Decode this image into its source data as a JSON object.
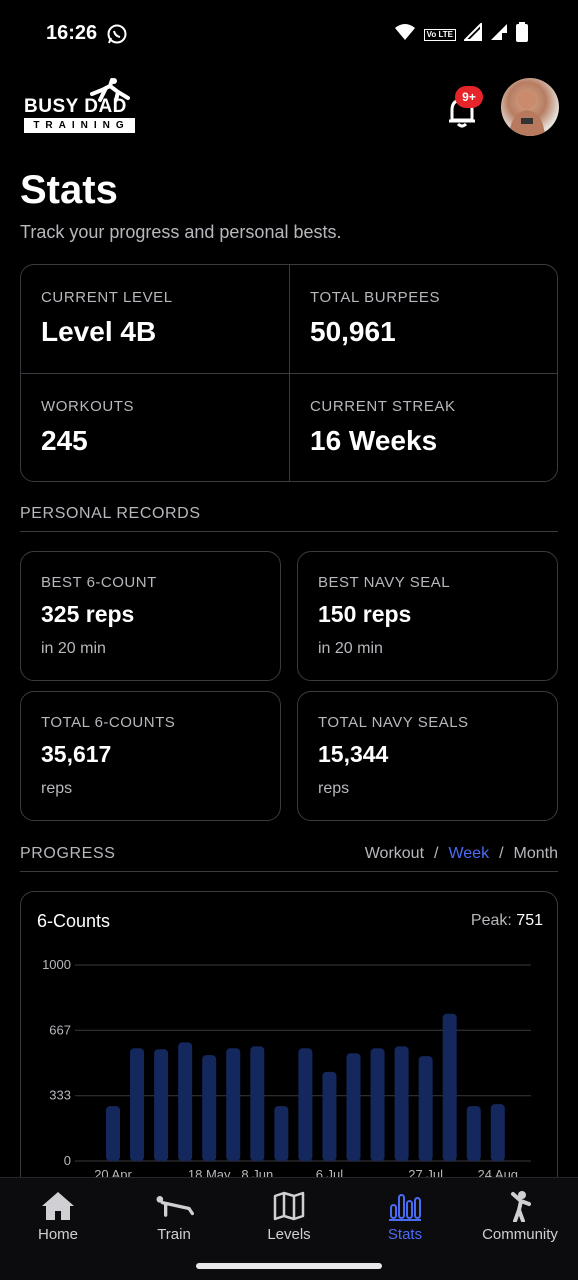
{
  "status_bar": {
    "time": "16:26",
    "icons": [
      "whatsapp-icon",
      "wifi-icon",
      "volte-icon",
      "signal-icon",
      "signal-r-icon",
      "battery-icon"
    ],
    "volte_text": "Vo LTE"
  },
  "header": {
    "logo_top": "BUSY DAD",
    "logo_bottom": "TRAINING",
    "notification_badge": "9+"
  },
  "page": {
    "title": "Stats",
    "subtitle": "Track your progress and personal bests."
  },
  "summary": [
    {
      "label": "CURRENT LEVEL",
      "value": "Level 4B"
    },
    {
      "label": "TOTAL BURPEES",
      "value": "50,961"
    },
    {
      "label": "WORKOUTS",
      "value": "245"
    },
    {
      "label": "CURRENT STREAK",
      "value": "16 Weeks"
    }
  ],
  "personal_records": {
    "heading": "PERSONAL RECORDS",
    "cards": [
      {
        "label": "BEST 6-COUNT",
        "value": "325 reps",
        "sub": "in 20 min"
      },
      {
        "label": "BEST NAVY SEAL",
        "value": "150 reps",
        "sub": "in 20 min"
      },
      {
        "label": "TOTAL 6-COUNTS",
        "value": "35,617",
        "sub": "reps"
      },
      {
        "label": "TOTAL NAVY SEALS",
        "value": "15,344",
        "sub": "reps"
      }
    ]
  },
  "progress": {
    "heading": "PROGRESS",
    "range_options": [
      "Workout",
      "Week",
      "Month"
    ],
    "range_separator": "/",
    "selected_range": "Week"
  },
  "chart_data": {
    "type": "bar",
    "title": "6-Counts",
    "peak_label": "Peak:",
    "peak_value": "751",
    "ylim": [
      0,
      1000
    ],
    "y_ticks": [
      "1000",
      "667",
      "333",
      "0"
    ],
    "x_tick_labels": [
      "20 Apr",
      "18 May",
      "8 Jun",
      "6 Jul",
      "27 Jul",
      "24 Aug"
    ],
    "x_tick_positions": [
      0,
      4,
      6,
      9,
      13,
      16
    ],
    "values": [
      280,
      575,
      570,
      605,
      540,
      575,
      585,
      280,
      575,
      455,
      550,
      575,
      585,
      535,
      751,
      280,
      290
    ],
    "bar_color": "#14285e",
    "grid": true
  },
  "bottom_nav": {
    "items": [
      {
        "label": "Home",
        "icon": "home-icon"
      },
      {
        "label": "Train",
        "icon": "pushup-icon"
      },
      {
        "label": "Levels",
        "icon": "map-icon"
      },
      {
        "label": "Stats",
        "icon": "bar-chart-icon"
      },
      {
        "label": "Community",
        "icon": "person-icon"
      }
    ],
    "active": "Stats",
    "active_color": "#4a6cf5"
  }
}
